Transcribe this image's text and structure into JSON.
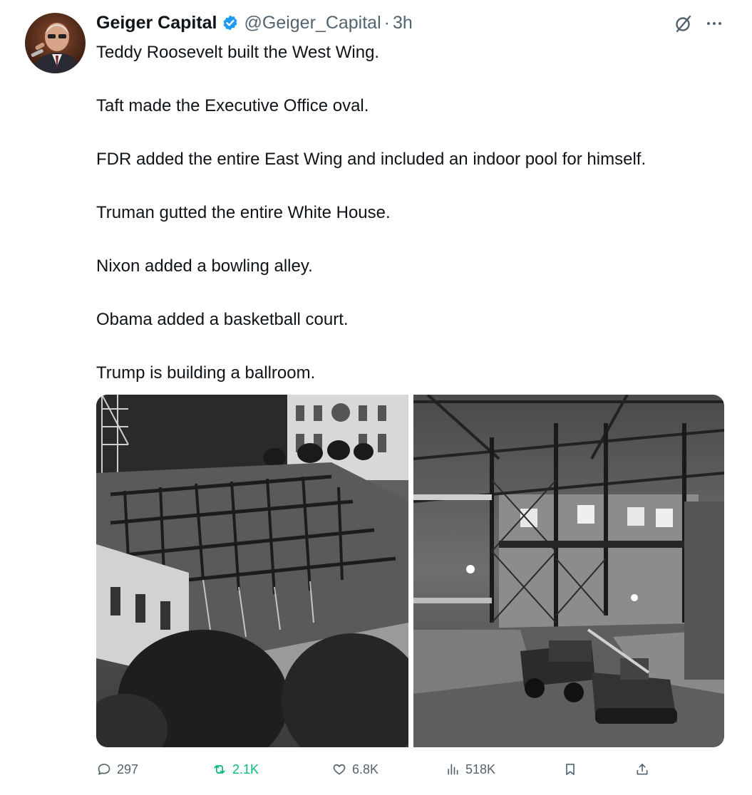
{
  "author": {
    "display_name": "Geiger Capital",
    "handle": "@Geiger_Capital",
    "separator": "·",
    "time": "3h",
    "verified_icon": "verified-badge-icon",
    "colors": {
      "verified": "#1d9bf0"
    }
  },
  "tweet": {
    "lines": [
      "Teddy Roosevelt built the West Wing.",
      "Taft made the Executive Office oval.",
      "FDR added the entire East Wing and included an indoor pool for himself.",
      "Truman gutted the entire White House.",
      "Nixon added a bowling alley.",
      "Obama added a basketball court.",
      "Trump is building a ballroom."
    ]
  },
  "media": {
    "count": 2,
    "photos": [
      {
        "icon": "photo-construction-east-wing"
      },
      {
        "icon": "photo-white-house-gutted-interior"
      }
    ]
  },
  "actions": {
    "replies": "297",
    "retweets": "2.1K",
    "likes": "6.8K",
    "views": "518K",
    "colors": {
      "default": "#536471",
      "retweet": "#00ba7c"
    }
  }
}
